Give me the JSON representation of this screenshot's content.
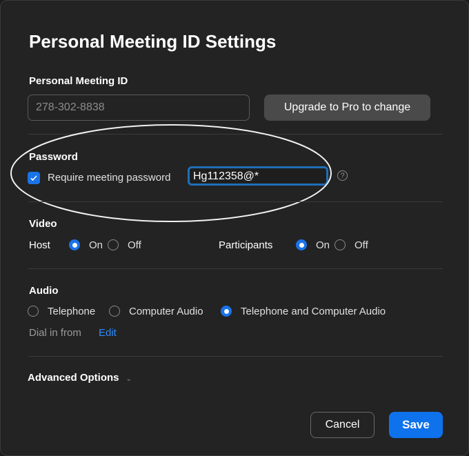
{
  "title": "Personal Meeting ID Settings",
  "pmi": {
    "label": "Personal Meeting ID",
    "value": "278-302-8838",
    "upgrade_button": "Upgrade to Pro to change"
  },
  "password": {
    "label": "Password",
    "checkbox_label": "Require meeting password",
    "checked": true,
    "value": "Hg112358@*",
    "help_icon": "question-circle-icon"
  },
  "video": {
    "label": "Video",
    "host_label": "Host",
    "participants_label": "Participants",
    "on": "On",
    "off": "Off",
    "host_selected": "On",
    "participants_selected": "On"
  },
  "audio": {
    "label": "Audio",
    "options": [
      "Telephone",
      "Computer Audio",
      "Telephone and Computer Audio"
    ],
    "selected": "Telephone and Computer Audio",
    "dial_in_label": "Dial in from",
    "edit_link": "Edit"
  },
  "advanced": {
    "label": "Advanced Options"
  },
  "buttons": {
    "cancel": "Cancel",
    "save": "Save"
  },
  "colors": {
    "accent": "#1a73e8",
    "background": "#232323",
    "link": "#2d8cff"
  }
}
